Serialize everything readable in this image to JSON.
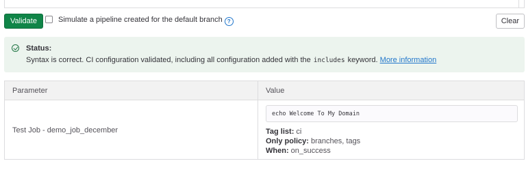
{
  "toolbar": {
    "validate_label": "Validate",
    "simulate_label": "Simulate a pipeline created for the default branch",
    "help_icon": "question-circle-icon",
    "clear_label": "Clear"
  },
  "status": {
    "icon": "check-circle-icon",
    "title": "Status:",
    "message_pre": "Syntax is correct. CI configuration validated, including all configuration added with the",
    "code": "includes",
    "message_post": "keyword.",
    "link": "More information"
  },
  "table": {
    "headers": [
      "Parameter",
      "Value"
    ],
    "rows": [
      {
        "parameter": "Test Job - demo_job_december",
        "script": "echo Welcome To My Domain",
        "tag_list_label": "Tag list:",
        "tag_list": "ci",
        "only_policy_label": "Only policy:",
        "only_policy": "branches, tags",
        "when_label": "When:",
        "when": "on_success"
      }
    ]
  },
  "colors": {
    "primary_green": "#108548",
    "success_bg": "#ecf4ee",
    "link_blue": "#1f75cb"
  }
}
